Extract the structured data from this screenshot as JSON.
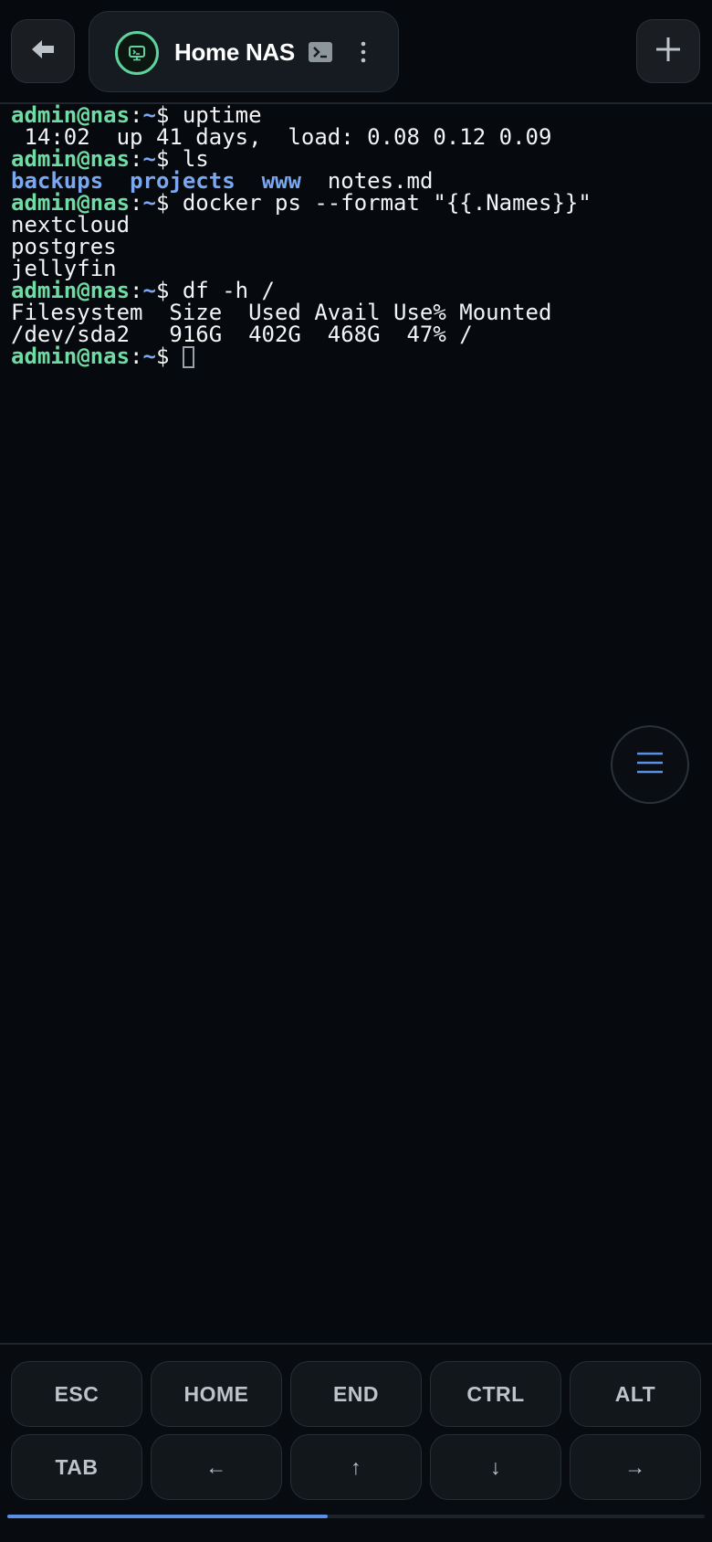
{
  "header": {
    "back_icon": "arrow-left-icon",
    "session_title": "Home NAS",
    "session_icon": "terminal-monitor-icon",
    "terminal_icon": "terminal-prompt-icon",
    "more_icon": "vertical-dots-icon",
    "add_icon": "plus-icon"
  },
  "terminal": {
    "prompt_user": "admin@nas",
    "prompt_sep": ":",
    "prompt_path": "~",
    "prompt_symbol": "$ ",
    "lines": [
      {
        "type": "prompt",
        "command": "uptime"
      },
      {
        "type": "out",
        "text": " 14:02  up 41 days,  load: 0.08 0.12 0.09"
      },
      {
        "type": "prompt",
        "command": "ls"
      },
      {
        "type": "ls",
        "dirs": [
          "backups",
          "projects",
          "www"
        ],
        "files": [
          "notes.md"
        ]
      },
      {
        "type": "prompt",
        "command": "docker ps --format \"{{.Names}}\""
      },
      {
        "type": "out",
        "text": "nextcloud"
      },
      {
        "type": "out",
        "text": "postgres"
      },
      {
        "type": "out",
        "text": "jellyfin"
      },
      {
        "type": "prompt",
        "command": "df -h /"
      },
      {
        "type": "out",
        "text": "Filesystem  Size  Used Avail Use% Mounted"
      },
      {
        "type": "out",
        "text": "/dev/sda2   916G  402G  468G  47% /"
      },
      {
        "type": "prompt_cursor",
        "command": ""
      }
    ]
  },
  "fab": {
    "icon": "hamburger-menu-icon"
  },
  "extra_keys": {
    "row1": [
      "ESC",
      "HOME",
      "END",
      "CTRL",
      "ALT"
    ],
    "row2": [
      "TAB",
      "←",
      "↑",
      "↓",
      "→"
    ]
  },
  "pager": {
    "progress": 0.46
  },
  "colors": {
    "background": "#06090d",
    "prompt_user": "#6fdca4",
    "prompt_path": "#7aa7ef",
    "accent": "#5b8fe6"
  }
}
